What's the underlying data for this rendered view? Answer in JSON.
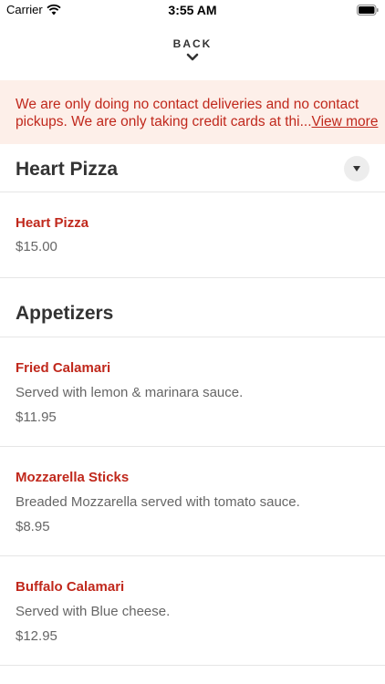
{
  "status_bar": {
    "carrier": "Carrier",
    "time": "3:55 AM"
  },
  "nav": {
    "back_label": "BACK"
  },
  "notice": {
    "text": "We are only doing no contact deliveries and no contact pickups. We are only taking credit cards at thi...",
    "line1": "We are only doing no contact deliveries and no contact",
    "line2": "pickups. We are only taking credit cards at thi...",
    "more_label": "View more"
  },
  "sections": [
    {
      "title": "Heart Pizza",
      "items": [
        {
          "name": "Heart Pizza",
          "description": "",
          "price": "$15.00"
        }
      ]
    },
    {
      "title": "Appetizers",
      "items": [
        {
          "name": "Fried Calamari",
          "description": "Served with lemon & marinara sauce.",
          "price": "$11.95"
        },
        {
          "name": "Mozzarella Sticks",
          "description": "Breaded Mozzarella served with tomato sauce.",
          "price": "$8.95"
        },
        {
          "name": "Buffalo Calamari",
          "description": "Served with Blue cheese.",
          "price": "$12.95"
        }
      ]
    }
  ],
  "colors": {
    "accent": "#c0281c",
    "banner_bg": "#fdefe9",
    "text": "#333333",
    "muted": "#666666"
  }
}
